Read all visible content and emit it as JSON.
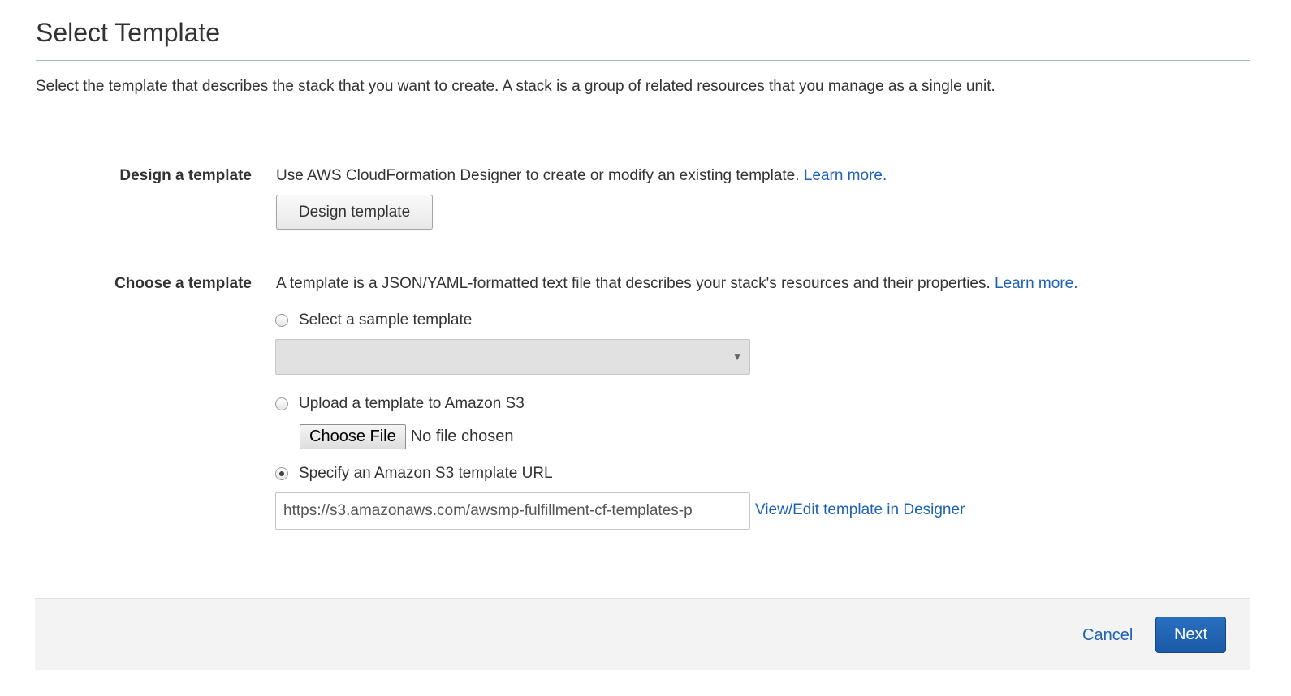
{
  "page": {
    "title": "Select Template",
    "intro": "Select the template that describes the stack that you want to create. A stack is a group of related resources that you manage as a single unit."
  },
  "design_section": {
    "label": "Design a template",
    "description": "Use AWS CloudFormation Designer to create or modify an existing template.",
    "learn_more": "Learn more.",
    "button_label": "Design template"
  },
  "choose_section": {
    "label": "Choose a template",
    "description": "A template is a JSON/YAML-formatted text file that describes your stack's resources and their properties.",
    "learn_more": "Learn more.",
    "options": {
      "sample": {
        "label": "Select a sample template",
        "selected": false,
        "dropdown_value": ""
      },
      "upload": {
        "label": "Upload a template to Amazon S3",
        "selected": false,
        "choose_file_label": "Choose File",
        "file_status": "No file chosen"
      },
      "url": {
        "label": "Specify an Amazon S3 template URL",
        "selected": true,
        "value": "https://s3.amazonaws.com/awsmp-fulfillment-cf-templates-p",
        "designer_link": "View/Edit template in Designer"
      }
    }
  },
  "footer": {
    "cancel_label": "Cancel",
    "next_label": "Next"
  },
  "colors": {
    "link": "#1e62b4",
    "primary_button": "#1f62b0",
    "footer_background": "#f3f3f3"
  },
  "icons": {
    "dropdown": "triangle-down-icon"
  }
}
